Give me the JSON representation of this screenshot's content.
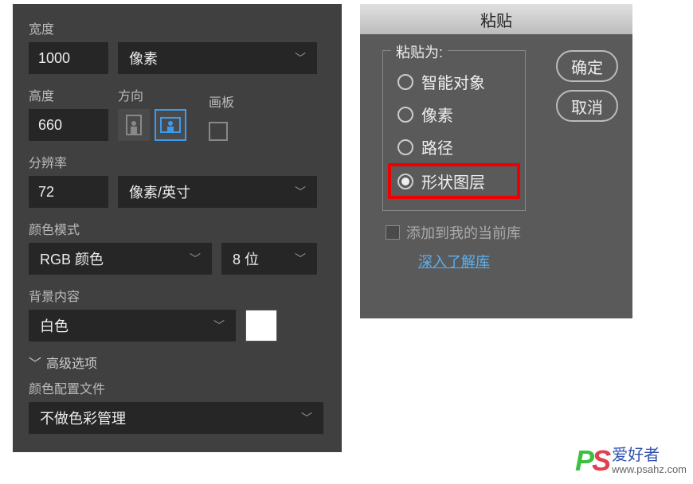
{
  "left": {
    "width_label": "宽度",
    "width_value": "1000",
    "width_unit": "像素",
    "height_label": "高度",
    "height_value": "660",
    "orientation_label": "方向",
    "artboard_label": "画板",
    "resolution_label": "分辨率",
    "resolution_value": "72",
    "resolution_unit": "像素/英寸",
    "color_mode_label": "颜色模式",
    "color_mode_value": "RGB 颜色",
    "color_depth": "8 位",
    "background_label": "背景内容",
    "background_value": "白色",
    "advanced_label": "高级选项",
    "profile_label": "颜色配置文件",
    "profile_value": "不做色彩管理"
  },
  "right": {
    "title": "粘贴",
    "paste_as_label": "粘贴为:",
    "options": {
      "smart_object": "智能对象",
      "pixels": "像素",
      "path": "路径",
      "shape_layer": "形状图层"
    },
    "add_to_library": "添加到我的当前库",
    "learn_more": "深入了解库",
    "ok": "确定",
    "cancel": "取消"
  },
  "watermark": {
    "text": "爱好者",
    "url": "www.psahz.com"
  }
}
